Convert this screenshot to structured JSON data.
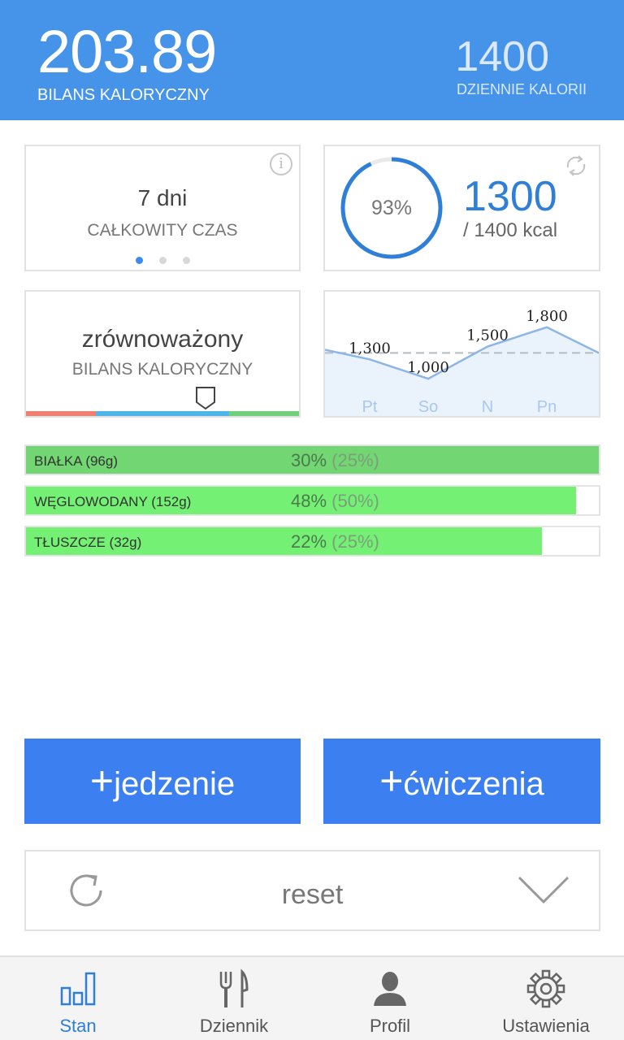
{
  "header": {
    "balance_value": "203.89",
    "balance_label": "BILANS KALORYCZNY",
    "daily_value": "1400",
    "daily_label": "DZIENNIE KALORII"
  },
  "time_card": {
    "value": "7 dni",
    "label": "CAŁKOWITY CZAS",
    "info_icon": "info-icon",
    "pages": 3,
    "active_page": 0
  },
  "calorie_card": {
    "percent_text": "93%",
    "percent": 0.93,
    "consumed": "1300",
    "target_text": "/ 1400 kcal",
    "icon": "refresh-arrows-icon"
  },
  "balance_card": {
    "status": "zrównoważony",
    "label": "BILANS KALORYCZNY",
    "colors": {
      "low": "#f07f73",
      "mid": "#4fb4e8",
      "high": "#6fcf7a"
    }
  },
  "chart_data": {
    "type": "area",
    "categories": [
      "Pt",
      "So",
      "N",
      "Pn"
    ],
    "values": [
      1300,
      1000,
      1500,
      1800
    ],
    "value_labels": [
      "1,300",
      "1,000",
      "1,500",
      "1,800"
    ],
    "reference_line": 1400,
    "title": "",
    "xlabel": "",
    "ylabel": "",
    "grid": false
  },
  "macros": [
    {
      "name": "BIAŁKA (96g)",
      "percent_text": "30%",
      "target_text": "(25%)",
      "fill": 1.0,
      "color": "#72d672"
    },
    {
      "name": "WĘGLOWODANY (152g)",
      "percent_text": "48%",
      "target_text": "(50%)",
      "fill": 0.96,
      "color": "#74f074"
    },
    {
      "name": "TŁUSZCZE (32g)",
      "percent_text": "22%",
      "target_text": "(25%)",
      "fill": 0.9,
      "color": "#74f074"
    }
  ],
  "actions": {
    "food": {
      "plus": "+",
      "label": "jedzenie"
    },
    "exercise": {
      "plus": "+",
      "label": "ćwiczenia"
    }
  },
  "reset": {
    "label": "reset",
    "icon": "refresh-icon",
    "expand_icon": "chevron-down-icon"
  },
  "tabs": [
    {
      "label": "Stan",
      "icon": "bar-chart-icon",
      "active": true
    },
    {
      "label": "Dziennik",
      "icon": "fork-knife-icon",
      "active": false
    },
    {
      "label": "Profil",
      "icon": "person-icon",
      "active": false
    },
    {
      "label": "Ustawienia",
      "icon": "gear-icon",
      "active": false
    }
  ],
  "accent_color": "#4693ea"
}
